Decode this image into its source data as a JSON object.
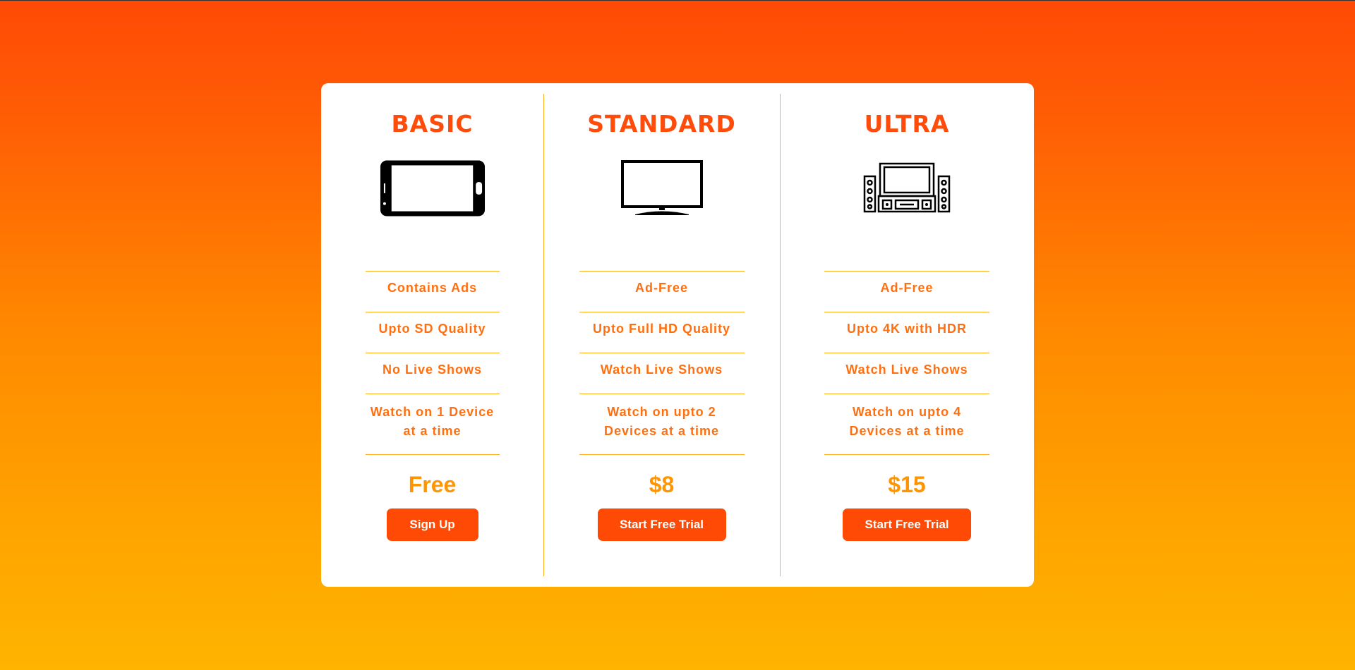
{
  "colors": {
    "accent": "#ff4a05",
    "feature_text": "#ff6f0f",
    "price_text": "#ff9500",
    "divider": "#ffb01f"
  },
  "plans": [
    {
      "title": "BASIC",
      "icon": "smartphone-icon",
      "features": [
        "Contains Ads",
        "Upto SD Quality",
        "No Live Shows",
        "Watch on 1 Device at a time"
      ],
      "price": "Free",
      "button_label": "Sign Up"
    },
    {
      "title": "STANDARD",
      "icon": "tv-icon",
      "features": [
        "Ad-Free",
        "Upto Full HD Quality",
        "Watch Live Shows",
        "Watch on upto 2 Devices at a time"
      ],
      "price": "$8",
      "button_label": "Start Free Trial"
    },
    {
      "title": "ULTRA",
      "icon": "home-theater-icon",
      "features": [
        "Ad-Free",
        "Upto 4K with HDR",
        "Watch Live Shows",
        "Watch on upto 4 Devices at a time"
      ],
      "price": "$15",
      "button_label": "Start Free Trial"
    }
  ]
}
